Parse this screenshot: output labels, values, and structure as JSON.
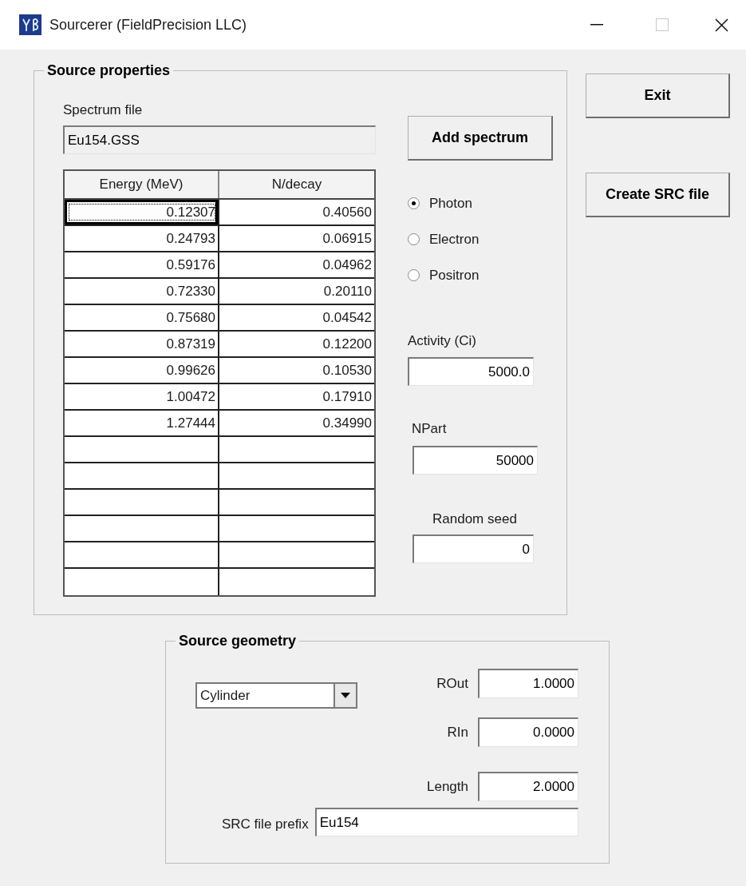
{
  "window": {
    "title": "Sourcerer (FieldPrecision LLC)"
  },
  "source_properties": {
    "legend": "Source properties",
    "spectrum_file": {
      "label": "Spectrum file",
      "value": "Eu154.GSS"
    },
    "add_button": "Add spectrum",
    "table": {
      "columns": [
        "Energy (MeV)",
        "N/decay"
      ],
      "rows": [
        {
          "cells": [
            "0.12307",
            "0.40560"
          ],
          "selected": true
        },
        {
          "cells": [
            "0.24793",
            "0.06915"
          ],
          "selected": false
        },
        {
          "cells": [
            "0.59176",
            "0.04962"
          ],
          "selected": false
        },
        {
          "cells": [
            "0.72330",
            "0.20110"
          ],
          "selected": false
        },
        {
          "cells": [
            "0.75680",
            "0.04542"
          ],
          "selected": false
        },
        {
          "cells": [
            "0.87319",
            "0.12200"
          ],
          "selected": false
        },
        {
          "cells": [
            "0.99626",
            "0.10530"
          ],
          "selected": false
        },
        {
          "cells": [
            "1.00472",
            "0.17910"
          ],
          "selected": false
        },
        {
          "cells": [
            "1.27444",
            "0.34990"
          ],
          "selected": false
        }
      ]
    },
    "particles": [
      {
        "label": "Photon",
        "selected": true
      },
      {
        "label": "Electron",
        "selected": false
      },
      {
        "label": "Positron",
        "selected": false
      }
    ],
    "activity": {
      "label": "Activity (Ci)",
      "value": "5000.0"
    },
    "npart": {
      "label": "NPart",
      "value": "50000"
    },
    "random_seed": {
      "label": "Random seed",
      "value": "0"
    }
  },
  "buttons": [
    "Exit",
    "Create SRC file"
  ],
  "source_geometry": {
    "legend": "Source geometry",
    "shape": "Cylinder",
    "fields": [
      {
        "label": "ROut",
        "value": "1.0000"
      },
      {
        "label": "RIn",
        "value": "0.0000"
      },
      {
        "label": "Length",
        "value": "2.0000"
      }
    ],
    "prefix": {
      "label": "SRC file prefix",
      "value": "Eu154"
    }
  }
}
